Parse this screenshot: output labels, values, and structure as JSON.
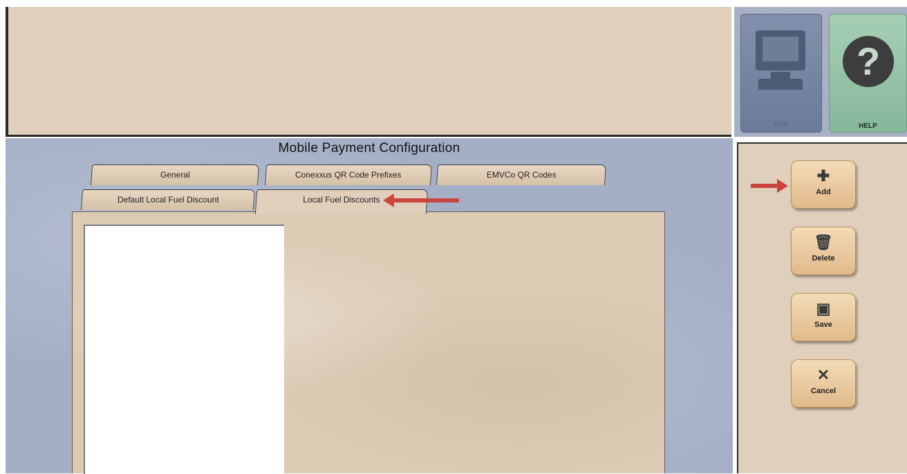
{
  "window": {
    "title": "Mobile Payment Configuration"
  },
  "top_buttons": {
    "pos_label": "POS",
    "help_label": "HELP",
    "help_glyph": "?"
  },
  "tabs": [
    {
      "label": "General",
      "active": false
    },
    {
      "label": "Conexxus QR Code Prefixes",
      "active": false
    },
    {
      "label": "EMVCo QR Codes",
      "active": false
    },
    {
      "label": "Default Local Fuel Discount",
      "active": false
    },
    {
      "label": "Local Fuel Discounts",
      "active": true
    }
  ],
  "actions": {
    "add_label": "Add",
    "add_icon": "plus-icon",
    "delete_label": "Delete",
    "delete_icon": "trash-icon",
    "save_label": "Save",
    "save_icon": "floppy-disk-icon",
    "cancel_label": "Cancel",
    "cancel_icon": "x-icon"
  },
  "colors": {
    "annotation_arrow": "#c9453f",
    "panel_beige": "#dfcfbb",
    "main_blue": "#a4afc6",
    "button_tan": "#e1b98a"
  }
}
